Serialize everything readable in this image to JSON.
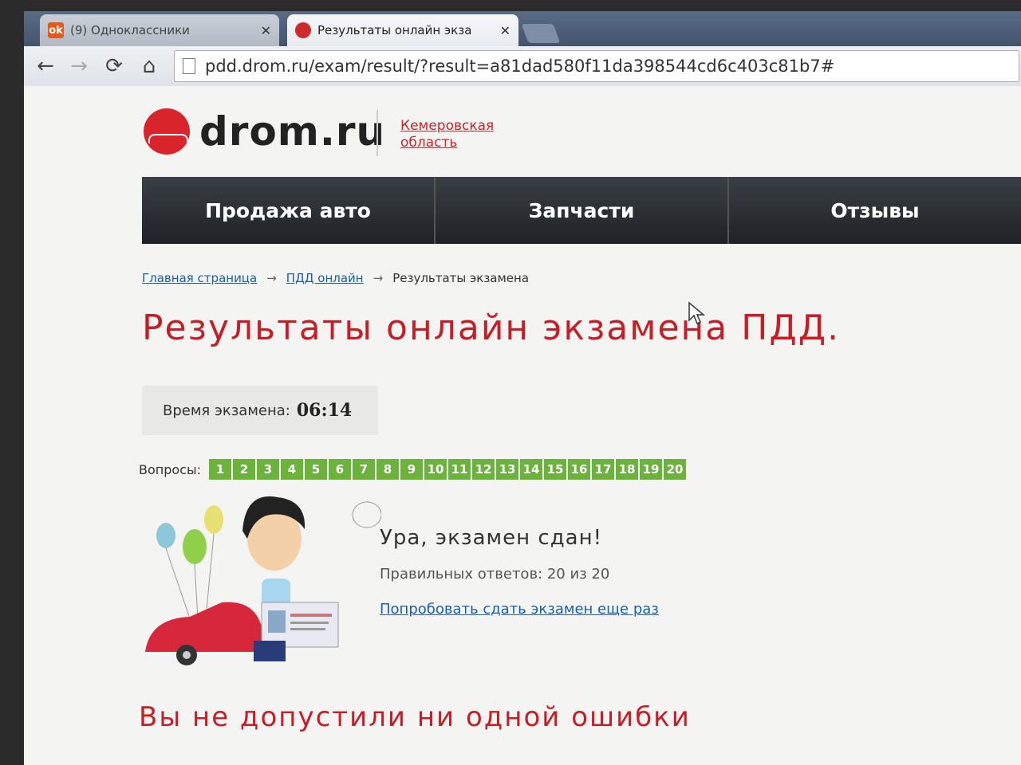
{
  "browser": {
    "tabs": [
      {
        "label": "(9) Одноклассники",
        "active": false
      },
      {
        "label": "Результаты онлайн экза",
        "active": true
      }
    ],
    "url": "pdd.drom.ru/exam/result/?result=a81dad580f11da398544cd6c403c81b7#",
    "icons": {
      "back": "arrow-left-icon",
      "forward": "arrow-right-icon",
      "reload": "reload-icon",
      "home": "home-icon"
    }
  },
  "site": {
    "logo_text": "drom.ru",
    "region_label": "Кемеровская область",
    "brand_color": "#d9242b"
  },
  "menu": {
    "items": [
      "Продажа авто",
      "Запчасти",
      "Отзывы"
    ]
  },
  "breadcrumbs": {
    "home": "Главная страница",
    "pdd": "ПДД онлайн",
    "current": "Результаты экзамена",
    "separator": "→"
  },
  "exam": {
    "title": "Результаты онлайн экзамена ПДД.",
    "time_label": "Время экзамена:",
    "time_value": "06:14",
    "questions_label": "Вопросы:",
    "questions": [
      "1",
      "2",
      "3",
      "4",
      "5",
      "6",
      "7",
      "8",
      "9",
      "10",
      "11",
      "12",
      "13",
      "14",
      "15",
      "16",
      "17",
      "18",
      "19",
      "20"
    ],
    "question_color": "#6bb33c",
    "result_heading": "Ура, экзамен сдан!",
    "score_text": "Правильных ответов: 20 из 20",
    "retry_link": "Попробовать сдать экзамен еще раз",
    "no_errors_text": "Вы не допустили ни одной ошибки"
  }
}
